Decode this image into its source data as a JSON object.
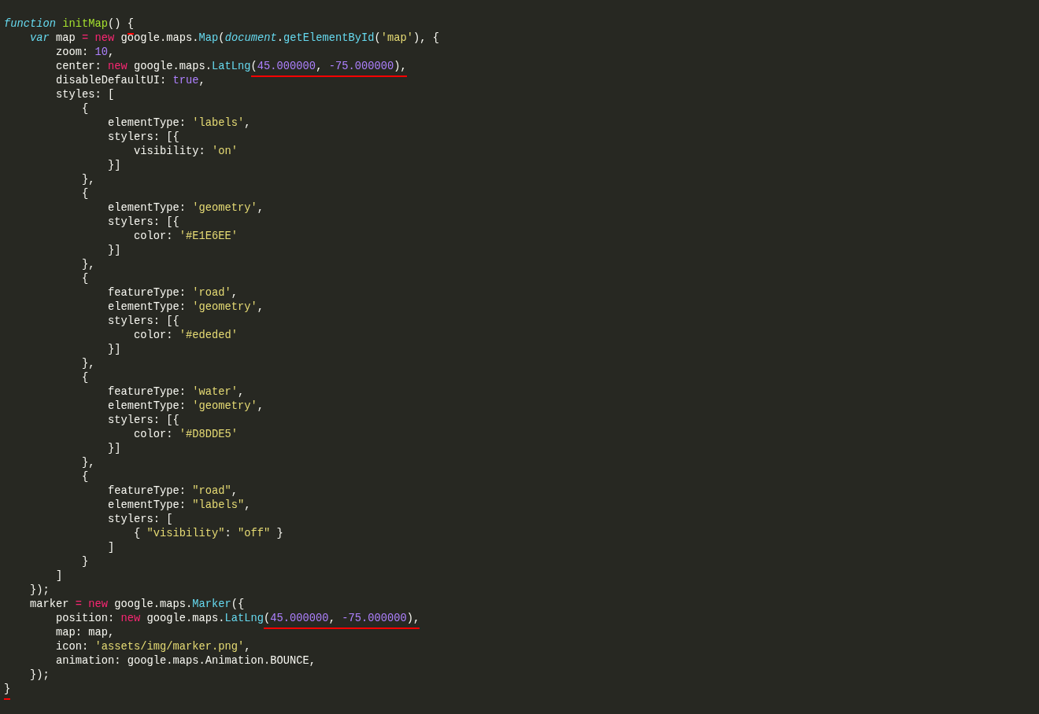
{
  "editor": {
    "lines": [
      {
        "tokens": [
          {
            "kind": "st",
            "text": "function"
          },
          {
            "kind": "fn",
            "text": " initMap"
          },
          {
            "kind": "p",
            "text": "() "
          },
          {
            "kind": "p",
            "text": "{",
            "underlined": true
          }
        ]
      },
      {
        "tokens": [
          {
            "kind": "st",
            "text": "    var"
          },
          {
            "kind": "p",
            "text": " map "
          },
          {
            "kind": "kw",
            "text": "="
          },
          {
            "kind": "kw",
            "text": " new"
          },
          {
            "kind": "p",
            "text": " google.maps."
          },
          {
            "kind": "sup",
            "text": "Map"
          },
          {
            "kind": "p",
            "text": "("
          },
          {
            "kind": "supi",
            "text": "document"
          },
          {
            "kind": "p",
            "text": "."
          },
          {
            "kind": "sup",
            "text": "getElementById"
          },
          {
            "kind": "p",
            "text": "("
          },
          {
            "kind": "str",
            "text": "'map'"
          },
          {
            "kind": "p",
            "text": "), {"
          }
        ]
      },
      {
        "tokens": [
          {
            "kind": "p",
            "text": "        zoom: "
          },
          {
            "kind": "num",
            "text": "10"
          },
          {
            "kind": "p",
            "text": ","
          }
        ]
      },
      {
        "tokens": [
          {
            "kind": "p",
            "text": "        center: "
          },
          {
            "kind": "kw",
            "text": "new"
          },
          {
            "kind": "p",
            "text": " google.maps."
          },
          {
            "kind": "sup",
            "text": "LatLng"
          },
          {
            "kind": "p",
            "text": "(",
            "underlined": true
          },
          {
            "kind": "num",
            "text": "45.000000",
            "underlined": true
          },
          {
            "kind": "p",
            "text": ", ",
            "underlined": true
          },
          {
            "kind": "num",
            "text": "-75.000000",
            "underlined": true
          },
          {
            "kind": "p",
            "text": "),",
            "underlined": true
          }
        ]
      },
      {
        "tokens": [
          {
            "kind": "p",
            "text": "        disableDefaultUI: "
          },
          {
            "kind": "num",
            "text": "true"
          },
          {
            "kind": "p",
            "text": ","
          }
        ]
      },
      {
        "tokens": [
          {
            "kind": "p",
            "text": "        styles: ["
          }
        ]
      },
      {
        "tokens": [
          {
            "kind": "p",
            "text": "            {"
          }
        ]
      },
      {
        "tokens": [
          {
            "kind": "p",
            "text": "                elementType: "
          },
          {
            "kind": "str",
            "text": "'labels'"
          },
          {
            "kind": "p",
            "text": ","
          }
        ]
      },
      {
        "tokens": [
          {
            "kind": "p",
            "text": "                stylers: [{"
          }
        ]
      },
      {
        "tokens": [
          {
            "kind": "p",
            "text": "                    visibility: "
          },
          {
            "kind": "str",
            "text": "'on'"
          }
        ]
      },
      {
        "tokens": [
          {
            "kind": "p",
            "text": "                }]"
          }
        ]
      },
      {
        "tokens": [
          {
            "kind": "p",
            "text": "            },"
          }
        ]
      },
      {
        "tokens": [
          {
            "kind": "p",
            "text": "            {"
          }
        ]
      },
      {
        "tokens": [
          {
            "kind": "p",
            "text": "                elementType: "
          },
          {
            "kind": "str",
            "text": "'geometry'"
          },
          {
            "kind": "p",
            "text": ","
          }
        ]
      },
      {
        "tokens": [
          {
            "kind": "p",
            "text": "                stylers: [{"
          }
        ]
      },
      {
        "tokens": [
          {
            "kind": "p",
            "text": "                    color: "
          },
          {
            "kind": "str",
            "text": "'#E1E6EE'"
          }
        ]
      },
      {
        "tokens": [
          {
            "kind": "p",
            "text": "                }]"
          }
        ]
      },
      {
        "tokens": [
          {
            "kind": "p",
            "text": "            },"
          }
        ]
      },
      {
        "tokens": [
          {
            "kind": "p",
            "text": "            {"
          }
        ]
      },
      {
        "tokens": [
          {
            "kind": "p",
            "text": "                featureType: "
          },
          {
            "kind": "str",
            "text": "'road'"
          },
          {
            "kind": "p",
            "text": ","
          }
        ]
      },
      {
        "tokens": [
          {
            "kind": "p",
            "text": "                elementType: "
          },
          {
            "kind": "str",
            "text": "'geometry'"
          },
          {
            "kind": "p",
            "text": ","
          }
        ]
      },
      {
        "tokens": [
          {
            "kind": "p",
            "text": "                stylers: [{"
          }
        ]
      },
      {
        "tokens": [
          {
            "kind": "p",
            "text": "                    color: "
          },
          {
            "kind": "str",
            "text": "'#ededed'"
          }
        ]
      },
      {
        "tokens": [
          {
            "kind": "p",
            "text": "                }]"
          }
        ]
      },
      {
        "tokens": [
          {
            "kind": "p",
            "text": "            },"
          }
        ]
      },
      {
        "tokens": [
          {
            "kind": "p",
            "text": "            {"
          }
        ]
      },
      {
        "tokens": [
          {
            "kind": "p",
            "text": "                featureType: "
          },
          {
            "kind": "str",
            "text": "'water'"
          },
          {
            "kind": "p",
            "text": ","
          }
        ]
      },
      {
        "tokens": [
          {
            "kind": "p",
            "text": "                elementType: "
          },
          {
            "kind": "str",
            "text": "'geometry'"
          },
          {
            "kind": "p",
            "text": ","
          }
        ]
      },
      {
        "tokens": [
          {
            "kind": "p",
            "text": "                stylers: [{"
          }
        ]
      },
      {
        "tokens": [
          {
            "kind": "p",
            "text": "                    color: "
          },
          {
            "kind": "str",
            "text": "'#D8DDE5'"
          }
        ]
      },
      {
        "tokens": [
          {
            "kind": "p",
            "text": "                }]"
          }
        ]
      },
      {
        "tokens": [
          {
            "kind": "p",
            "text": "            },"
          }
        ]
      },
      {
        "tokens": [
          {
            "kind": "p",
            "text": "            {"
          }
        ]
      },
      {
        "tokens": [
          {
            "kind": "p",
            "text": "                featureType: "
          },
          {
            "kind": "str",
            "text": "\"road\""
          },
          {
            "kind": "p",
            "text": ","
          }
        ]
      },
      {
        "tokens": [
          {
            "kind": "p",
            "text": "                elementType: "
          },
          {
            "kind": "str",
            "text": "\"labels\""
          },
          {
            "kind": "p",
            "text": ","
          }
        ]
      },
      {
        "tokens": [
          {
            "kind": "p",
            "text": "                stylers: ["
          }
        ]
      },
      {
        "tokens": [
          {
            "kind": "p",
            "text": "                    { "
          },
          {
            "kind": "str",
            "text": "\"visibility\""
          },
          {
            "kind": "p",
            "text": ": "
          },
          {
            "kind": "str",
            "text": "\"off\""
          },
          {
            "kind": "p",
            "text": " }"
          }
        ]
      },
      {
        "tokens": [
          {
            "kind": "p",
            "text": "                ]"
          }
        ]
      },
      {
        "tokens": [
          {
            "kind": "p",
            "text": "            }"
          }
        ]
      },
      {
        "tokens": [
          {
            "kind": "p",
            "text": "        ]"
          }
        ]
      },
      {
        "tokens": [
          {
            "kind": "p",
            "text": "    });"
          }
        ]
      },
      {
        "tokens": [
          {
            "kind": "p",
            "text": "    marker "
          },
          {
            "kind": "kw",
            "text": "="
          },
          {
            "kind": "kw",
            "text": " new"
          },
          {
            "kind": "p",
            "text": " google.maps."
          },
          {
            "kind": "sup",
            "text": "Marker"
          },
          {
            "kind": "p",
            "text": "({"
          }
        ]
      },
      {
        "tokens": [
          {
            "kind": "p",
            "text": "        position: "
          },
          {
            "kind": "kw",
            "text": "new"
          },
          {
            "kind": "p",
            "text": " google.maps."
          },
          {
            "kind": "sup",
            "text": "LatLng"
          },
          {
            "kind": "p",
            "text": "(",
            "underlined": true
          },
          {
            "kind": "num",
            "text": "45.000000",
            "underlined": true
          },
          {
            "kind": "p",
            "text": ", ",
            "underlined": true
          },
          {
            "kind": "num",
            "text": "-75.000000",
            "underlined": true
          },
          {
            "kind": "p",
            "text": "),",
            "underlined": true
          }
        ]
      },
      {
        "tokens": [
          {
            "kind": "p",
            "text": "        map: map,"
          }
        ]
      },
      {
        "tokens": [
          {
            "kind": "p",
            "text": "        icon: "
          },
          {
            "kind": "str",
            "text": "'assets/img/marker.png'"
          },
          {
            "kind": "p",
            "text": ","
          }
        ]
      },
      {
        "tokens": [
          {
            "kind": "p",
            "text": "        animation: google.maps.Animation.BOUNCE,"
          }
        ]
      },
      {
        "tokens": [
          {
            "kind": "p",
            "text": "    });"
          }
        ]
      },
      {
        "tokens": [
          {
            "kind": "p",
            "text": "}",
            "underlined": true
          }
        ]
      }
    ]
  }
}
